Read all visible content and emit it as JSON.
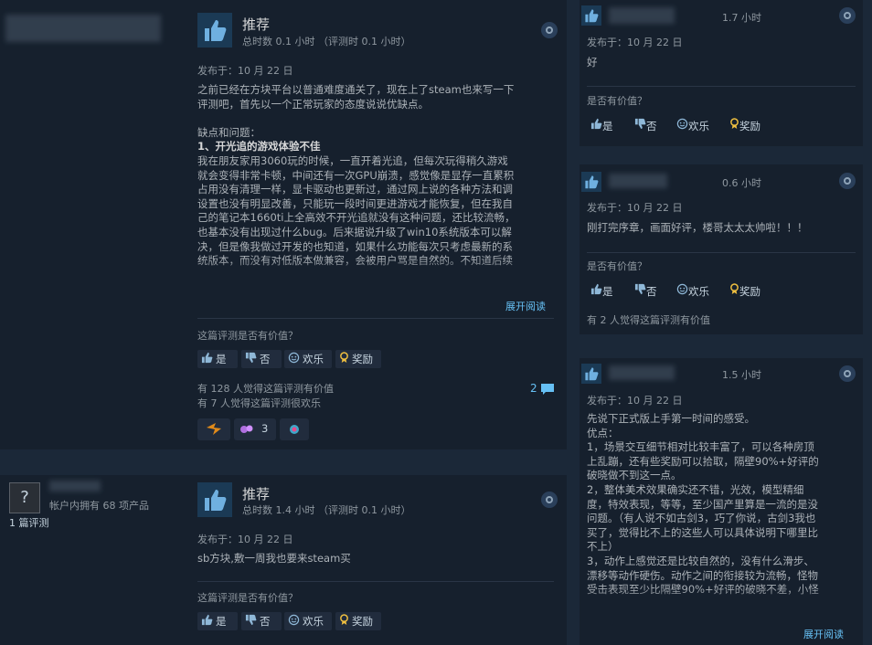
{
  "review1": {
    "rating": "推荐",
    "hours": "总时数 0.1 小时 （评测时 0.1 小时）",
    "posted": "发布于：10 月 22 日",
    "body_lines": [
      "之前已经在方块平台以普通难度通关了，现在上了steam也来写一下",
      "评测吧，首先以一个正常玩家的态度说说优缺点。",
      "",
      "缺点和问题：",
      "1、开光追的游戏体验不佳",
      "我在朋友家用3060玩的时候，一直开着光追，但每次玩得稍久游戏",
      "就会变得非常卡顿，中间还有一次GPU崩溃，感觉像是显存一直累积",
      "占用没有清理一样，显卡驱动也更新过，通过网上说的各种方法和调",
      "设置也没有明显改善，只能玩一段时间更进游戏才能恢复，但在我自",
      "己的笔记本1660ti上全高效不开光追就没有这种问题，还比较流畅，",
      "也基本没有出现过什么bug。后来据说升级了win10系统版本可以解",
      "决，但是像我做过开发的也知道，如果什么功能每次只考虑最新的系",
      "统版本，而没有对低版本做兼容，会被用户骂是自然的。不知道后续"
    ],
    "read_more": "展开阅读",
    "helpful_q": "这篇评测是否有价值？",
    "btn_yes": "是",
    "btn_no": "否",
    "btn_funny": "欢乐",
    "btn_award": "奖励",
    "count_helpful": "有 128 人觉得这篇评测有价值",
    "count_funny": "有 7 人觉得这篇评测很欢乐",
    "comments": "2",
    "award_count": "3"
  },
  "reviewer2": {
    "avatar_placeholder": "?",
    "products": "帐户内拥有 68 项产品",
    "reviews": "1 篇评测"
  },
  "review2": {
    "rating": "推荐",
    "hours": "总时数 1.4 小时 （评测时 0.1 小时）",
    "posted": "发布于：10 月 22 日",
    "body": "sb方块,敷一周我也要来steam买",
    "helpful_q": "这篇评测是否有价值？",
    "btn_yes": "是",
    "btn_no": "否",
    "btn_funny": "欢乐",
    "btn_award": "奖励"
  },
  "side1": {
    "hours": "1.7 小时",
    "posted": "发布于：10 月 22 日",
    "body": "好",
    "helpful_q": "是否有价值？",
    "btn_yes": "是",
    "btn_no": "否",
    "btn_funny": "欢乐",
    "btn_award": "奖励"
  },
  "side2": {
    "hours": "0.6 小时",
    "posted": "发布于：10 月 22 日",
    "body": "刚打完序章，画面好评，楼哥太太太帅啦！！！",
    "helpful_q": "是否有价值？",
    "btn_yes": "是",
    "btn_no": "否",
    "btn_funny": "欢乐",
    "btn_award": "奖励",
    "count": "有 2 人觉得这篇评测有价值"
  },
  "side3": {
    "hours": "1.5 小时",
    "posted": "发布于：10 月 22 日",
    "body_lines": [
      "先说下正式版上手第一时间的感受。",
      "优点：",
      "1，场景交互细节相对比较丰富了，可以各种房顶",
      "上乱蹦，还有些奖励可以拾取，隔壁90%+好评的",
      "破晓做不到这一点。",
      "2，整体美术效果确实还不错，光效，模型精细",
      "度，特效表现，等等，至少国产里算是一流的是没",
      "问题。（有人说不如古剑3，巧了你说，古剑3我也",
      "买了，觉得比不上的这些人可以具体说明下哪里比",
      "不上）",
      "3，动作上感觉还是比较自然的，没有什么滑步、",
      "漂移等动作硬伤。动作之间的衔接较为流畅，怪物",
      "受击表现至少比隔壁90%+好评的破晓不差，小怪"
    ],
    "read_more": "展开阅读"
  },
  "colors": {
    "bg": "#1b2838",
    "card": "#16202d",
    "link": "#66c0f4",
    "award": "#f0c040"
  }
}
